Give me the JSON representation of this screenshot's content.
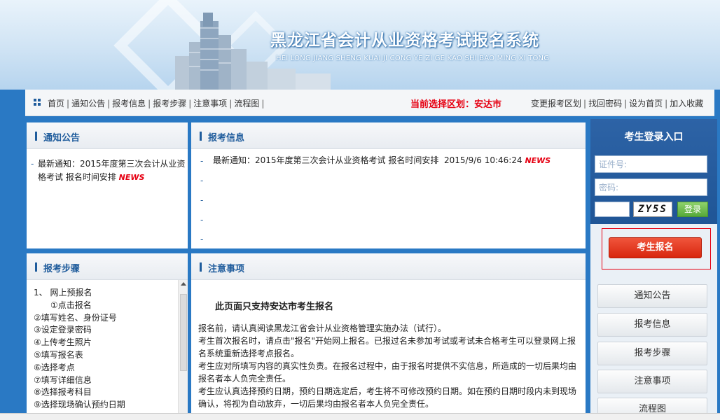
{
  "banner": {
    "title": "黑龙江省会计从业资格考试报名系统",
    "subtitle": "HEI LONG JIANG SHENG KUAI JI CONG YE ZI GE KAO SHI BAO MING XI TONG"
  },
  "nav": {
    "links": [
      "首页",
      "通知公告",
      "报考信息",
      "报考步骤",
      "注意事项",
      "流程图"
    ],
    "current_region": "当前选择区划：安达市",
    "right_links": [
      "变更报考区划",
      "找回密码",
      "设为首页",
      "加入收藏"
    ]
  },
  "notice_panel": {
    "title": "通知公告",
    "item_line1": "最新通知：2015年度第三次会计从业资",
    "item_line2": "格考试 报名时间安排",
    "news_badge": "NEWS"
  },
  "info_panel": {
    "title": "报考信息",
    "item": "最新通知：2015年度第三次会计从业资格考试 报名时间安排",
    "date": "2015/9/6 10:46:24",
    "news_badge": "NEWS"
  },
  "steps_panel": {
    "title": "报考步骤",
    "steps": [
      "1、  网上预报名",
      "①点击报名",
      "②填写姓名、身份证号",
      "③设定登录密码",
      "④上传考生照片",
      "⑤填写报名表",
      "⑥选择考点",
      "⑦填写详细信息",
      "⑧选择报考科目",
      "⑨选择现场确认预约日期"
    ]
  },
  "notes_panel": {
    "title": "注意事项",
    "heading": "此页面只支持安达市考生报名",
    "paragraphs": [
      "报名前，请认真阅读黑龙江省会计从业资格管理实施办法（试行）。",
      "考生首次报名时，请点击\"报名\"开始网上报名。已报过名未参加考试或考试未合格考生可以登录网上报名系统重新选择考点报名。",
      "考生应对所填写内容的真实性负责。在报名过程中，由于报名时提供不实信息，所造成的一切后果均由报名者本人负完全责任。",
      "考生应认真选择预约日期，预约日期选定后，考生将不可修改预约日期。如在预约日期时段内未到现场确认，将视为自动放弃，一切后果均由报名者本人负完全责任。"
    ]
  },
  "login": {
    "title": "考生登录入口",
    "id_placeholder": "证件号:",
    "password_placeholder": "密码:",
    "captcha": "ZY5S",
    "login_button": "登录"
  },
  "register_button": "考生报名",
  "side_buttons": [
    "通知公告",
    "报考信息",
    "报考步骤",
    "注意事项",
    "流程图"
  ],
  "colors": {
    "background_blue": "#2a79c4",
    "accent_blue": "#1f5c9c",
    "alert_red": "#e60012",
    "login_green": "#56a93a"
  }
}
